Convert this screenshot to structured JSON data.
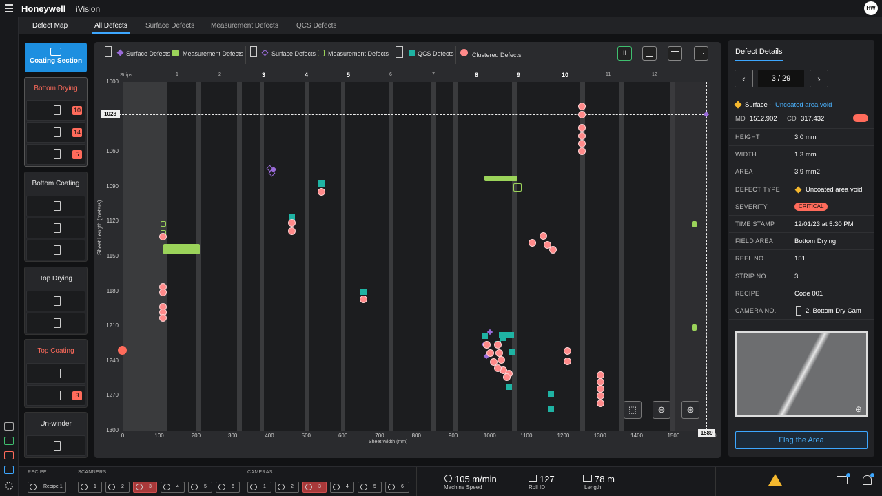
{
  "header": {
    "brand": "Honeywell",
    "app": "iVision",
    "avatar": "HW"
  },
  "tabs": [
    "Defect Map",
    "All Defects",
    "Surface Defects",
    "Measurement Defects",
    "QCS Defects"
  ],
  "sidebar": {
    "coating_section": "Coating Section",
    "groups": [
      {
        "title": "Bottom Drying",
        "alert": true,
        "badges": [
          "10",
          "14",
          "5"
        ]
      },
      {
        "title": "Bottom Coating",
        "alert": false,
        "badges": [
          "",
          "",
          ""
        ]
      },
      {
        "title": "Top Drying",
        "alert": false,
        "badges": [
          "",
          ""
        ]
      },
      {
        "title": "Top Coating",
        "alert": true,
        "badges": [
          "",
          "3"
        ]
      },
      {
        "title": "Un-winder",
        "alert": false,
        "badges": [
          ""
        ]
      }
    ]
  },
  "legend": {
    "surface1": "Surface Defects",
    "measure1": "Measurement Defects",
    "surface2": "Surface Defects",
    "measure2": "Measurement Defects",
    "qcs": "QCS Defects",
    "clustered": "Clustered Defects"
  },
  "toolbar": {
    "pause": "II",
    "more": "···"
  },
  "chart_data": {
    "type": "scatter",
    "xlabel": "Sheet Width (mm)",
    "ylabel": "Sheet Length (meters)",
    "strips_label": "Strips",
    "xlim": [
      0,
      1600
    ],
    "ylim": [
      1000,
      1300
    ],
    "xticks": [
      "0",
      "100",
      "200",
      "300",
      "400",
      "500",
      "600",
      "700",
      "800",
      "900",
      "1000",
      "1100",
      "1200",
      "1300",
      "1400",
      "1500",
      "1600"
    ],
    "yticks": [
      "1000",
      "1030",
      "1060",
      "1090",
      "1120",
      "1150",
      "1180",
      "1210",
      "1240",
      "1270",
      "1300"
    ],
    "strips": [
      "1",
      "2",
      "3",
      "4",
      "5",
      "6",
      "7",
      "8",
      "9",
      "10",
      "11",
      "12"
    ],
    "bold_strips": [
      "3",
      "4",
      "5",
      "8",
      "9",
      "10"
    ],
    "crosshair": {
      "x_label": "1589",
      "y_label": "1028",
      "x": 1589,
      "y": 1028
    },
    "clustered": [
      [
        108,
        1133
      ],
      [
        108,
        1176
      ],
      [
        108,
        1181
      ],
      [
        108,
        1193
      ],
      [
        108,
        1198
      ],
      [
        108,
        1203
      ],
      [
        460,
        1121
      ],
      [
        460,
        1128
      ],
      [
        540,
        1094
      ],
      [
        655,
        1187
      ],
      [
        990,
        1226
      ],
      [
        1000,
        1233
      ],
      [
        1010,
        1241
      ],
      [
        1020,
        1226
      ],
      [
        1025,
        1233
      ],
      [
        1030,
        1239
      ],
      [
        1035,
        1248
      ],
      [
        1050,
        1251
      ],
      [
        1020,
        1246
      ],
      [
        1045,
        1254
      ],
      [
        1115,
        1138
      ],
      [
        1145,
        1132
      ],
      [
        1155,
        1140
      ],
      [
        1170,
        1144
      ],
      [
        1250,
        1021
      ],
      [
        1250,
        1028
      ],
      [
        1250,
        1039
      ],
      [
        1250,
        1046
      ],
      [
        1250,
        1053
      ],
      [
        1250,
        1059
      ],
      [
        1210,
        1231
      ],
      [
        1210,
        1240
      ],
      [
        1300,
        1252
      ],
      [
        1300,
        1258
      ],
      [
        1300,
        1264
      ],
      [
        1300,
        1270
      ],
      [
        1300,
        1276
      ]
    ],
    "surface": [
      [
        410,
        1075
      ],
      [
        985,
        1226
      ],
      [
        990,
        1236
      ],
      [
        1000,
        1215
      ]
    ],
    "surface_open": [
      [
        400,
        1074
      ],
      [
        405,
        1078
      ]
    ],
    "measurement_bars": [
      [
        110,
        1144,
        100,
        9
      ],
      [
        985,
        1083,
        90,
        5
      ]
    ],
    "measurement_open": [
      [
        110,
        1122
      ],
      [
        110,
        1130
      ],
      [
        1075,
        1091
      ]
    ],
    "measurement_bars_right": [
      [
        1555,
        1122
      ],
      [
        1555,
        1211
      ]
    ],
    "qcs": [
      [
        540,
        1087
      ],
      [
        460,
        1116
      ],
      [
        655,
        1180
      ],
      [
        985,
        1218
      ],
      [
        1020,
        1225
      ],
      [
        1035,
        1220
      ],
      [
        1060,
        1232
      ],
      [
        1050,
        1262
      ],
      [
        1165,
        1268
      ],
      [
        1165,
        1281
      ]
    ]
  },
  "details": {
    "title": "Defect Details",
    "page": "3 / 29",
    "type_prefix": "Surface",
    "type_name": "Uncoated area void",
    "md_label": "MD",
    "md": "1512.902",
    "cd_label": "CD",
    "cd": "317.432",
    "rows": [
      [
        "HEIGHT",
        "3.0 mm"
      ],
      [
        "WIDTH",
        "1.3 mm"
      ],
      [
        "AREA",
        "3.9 mm2"
      ],
      [
        "DEFECT TYPE",
        "Uncoated area void"
      ],
      [
        "SEVERITY",
        "CRITICAL"
      ],
      [
        "TIME STAMP",
        "12/01/23 at 5:30 PM"
      ],
      [
        "FIELD AREA",
        "Bottom Drying"
      ],
      [
        "REEL NO.",
        "151"
      ],
      [
        "STRIP NO.",
        "3"
      ],
      [
        "RECIPE",
        "Code 001"
      ],
      [
        "CAMERA NO.",
        "2,  Bottom Dry Cam"
      ]
    ],
    "flag_button": "Flag the Area"
  },
  "bottom": {
    "recipe_label": "RECIPE",
    "recipe": "Recipe 1",
    "scanners_label": "SCANNERS",
    "scanners": [
      "1",
      "2",
      "3",
      "4",
      "5",
      "6"
    ],
    "cameras_label": "CAMERAS",
    "cameras": [
      "1",
      "2",
      "3",
      "4",
      "5",
      "6"
    ],
    "speed": "105 m/min",
    "speed_label": "Machine Speed",
    "roll": "127",
    "roll_label": "Roll ID",
    "length": "78 m",
    "length_label": "Length"
  },
  "colors": {
    "accent": "#1d8fe0",
    "critical": "#ff6b5b",
    "measure": "#9bd35a",
    "surface": "#9a6bd9",
    "qcs": "#1fb3a3",
    "cluster": "#ff8a8a"
  }
}
